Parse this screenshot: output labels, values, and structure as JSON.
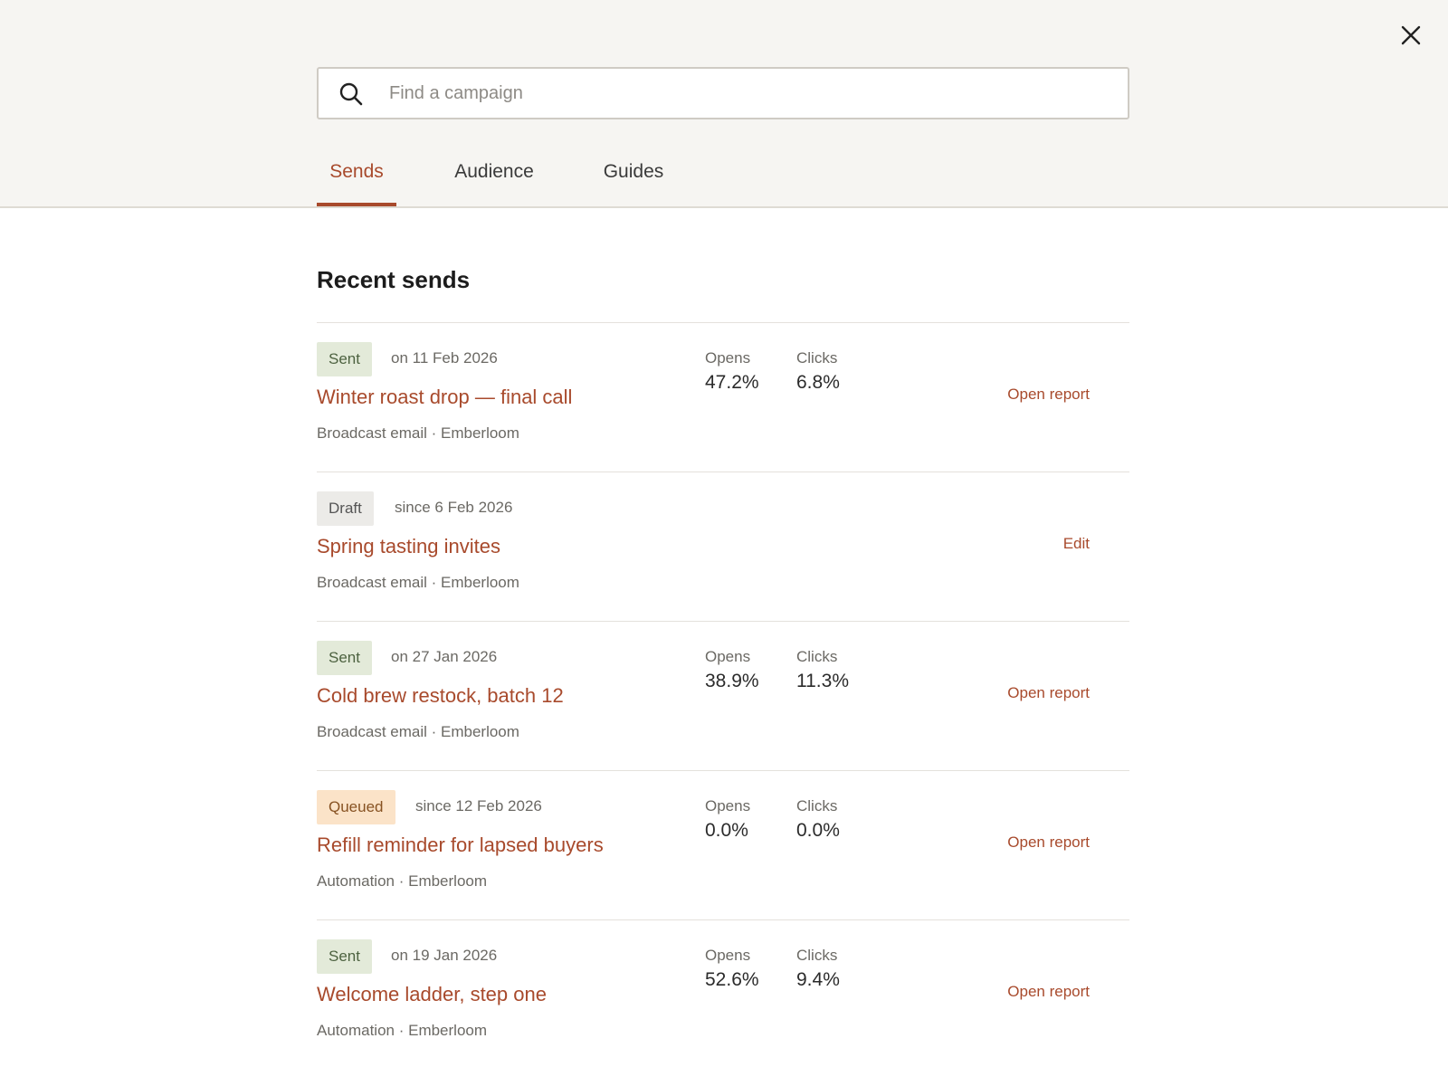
{
  "search": {
    "placeholder": "Find a campaign"
  },
  "tabs": [
    {
      "label": "Sends",
      "active": true
    },
    {
      "label": "Audience",
      "active": false
    },
    {
      "label": "Guides",
      "active": false
    }
  ],
  "section": {
    "title": "Recent sends"
  },
  "stat_labels": {
    "opens": "Opens",
    "clicks": "Clicks"
  },
  "sends": [
    {
      "status": "Sent",
      "date": "on 11 Feb 2026",
      "title": "Winter roast drop — final call",
      "meta": "Broadcast email · Emberloom",
      "opens": "47.2%",
      "clicks": "6.8%",
      "action": "Open report"
    },
    {
      "status": "Draft",
      "date": "since 6 Feb 2026",
      "title": "Spring tasting invites",
      "meta": "Broadcast email · Emberloom",
      "opens": null,
      "clicks": null,
      "action": "Edit"
    },
    {
      "status": "Sent",
      "date": "on 27 Jan 2026",
      "title": "Cold brew restock, batch 12",
      "meta": "Broadcast email · Emberloom",
      "opens": "38.9%",
      "clicks": "11.3%",
      "action": "Open report"
    },
    {
      "status": "Queued",
      "date": "since 12 Feb 2026",
      "title": "Refill reminder for lapsed buyers",
      "meta": "Automation · Emberloom",
      "opens": "0.0%",
      "clicks": "0.0%",
      "action": "Open report"
    },
    {
      "status": "Sent",
      "date": "on 19 Jan 2026",
      "title": "Welcome ladder, step one",
      "meta": "Automation · Emberloom",
      "opens": "52.6%",
      "clicks": "9.4%",
      "action": "Open report"
    }
  ],
  "colors": {
    "accent": "#a84a2c",
    "sent_badge": "#e3ead9",
    "draft_badge": "#ecebe8",
    "queued_badge": "#fbe3c8",
    "header_background": "#f6f5f2"
  },
  "icons": {
    "close": "close-icon",
    "search": "search-icon"
  }
}
